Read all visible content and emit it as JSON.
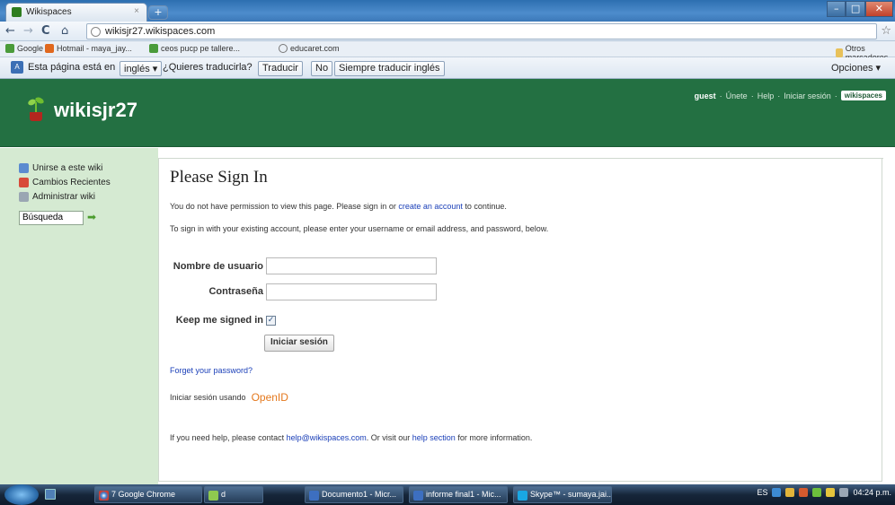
{
  "browser": {
    "tab_title": "Wikispaces",
    "tab_close": "×",
    "new_tab": "+",
    "url": "wikisjr27.wikispaces.com",
    "bookmarks": [
      "Google",
      "Hotmail - maya_jay...",
      "ceos pucp pe tallere...",
      "educaret.com"
    ],
    "other_bookmarks": "Otros marcadores",
    "translate": {
      "prefix": "Esta página está en",
      "language": "inglés ▾",
      "question": "¿Quieres traducirla?",
      "translate_btn": "Traducir",
      "no_btn": "No",
      "always_btn": "Siempre traducir inglés",
      "options": "Opciones ▾"
    }
  },
  "site": {
    "title": "wikisjr27",
    "user": "guest",
    "top_links": [
      "Únete",
      "Help",
      "Iniciar sesión"
    ],
    "logo": "wikispaces",
    "sidebar": {
      "items": [
        "Unirse a este wiki",
        "Cambios Recientes",
        "Administrar wiki"
      ],
      "search_value": "Búsqueda"
    }
  },
  "signin": {
    "heading": "Please Sign In",
    "p1_before": "You do not have permission to view this page. Please sign in or ",
    "p1_link": "create an account",
    "p1_after": " to continue.",
    "p2": "To sign in with your existing account, please enter your username or email address, and password, below.",
    "username_label": "Nombre de usuario",
    "password_label": "Contraseña",
    "keep_label": "Keep me signed in",
    "keep_checked": "✓",
    "submit": "Iniciar sesión",
    "forgot": "Forget your password?",
    "openid_prefix": "Iniciar sesión usando",
    "openid": "OpenID",
    "help_before": "If you need help, please contact ",
    "help_email": "help@wikispaces.com",
    "help_mid": ". Or visit our ",
    "help_link": "help section",
    "help_after": " for more information."
  },
  "taskbar": {
    "chrome": "7 Google Chrome",
    "d": "d",
    "items": [
      "Documento1 - Micr...",
      "informe final1 - Mic...",
      "Skype™ - sumaya.jai..."
    ],
    "lang": "ES",
    "clock": "04:24 p.m."
  }
}
